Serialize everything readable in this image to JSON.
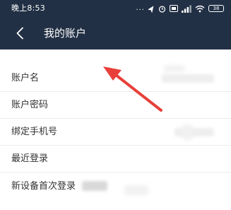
{
  "status_bar": {
    "time": "晚上8:53",
    "more_dots": "...",
    "battery": "38"
  },
  "header": {
    "title": "我的账户"
  },
  "rows": [
    {
      "label": "账户名"
    },
    {
      "label": "账户密码"
    },
    {
      "label": "绑定手机号"
    },
    {
      "label": "最近登录"
    },
    {
      "label": "新设备首次登录"
    }
  ],
  "colors": {
    "header_bg": "#223045",
    "arrow": "#e8403a"
  }
}
